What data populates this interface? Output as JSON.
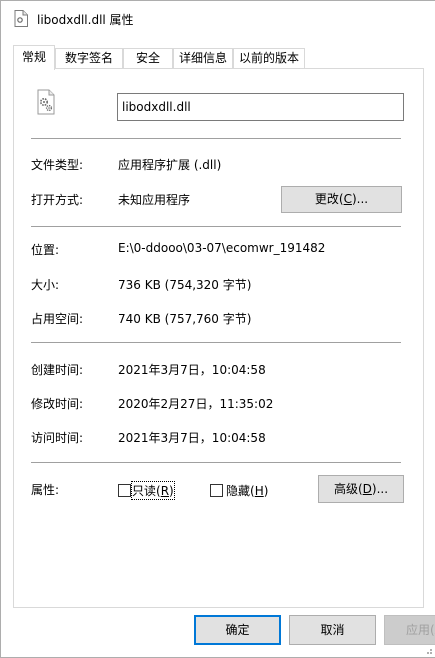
{
  "window": {
    "title": "libodxdll.dll 属性"
  },
  "tabs": [
    {
      "label": "常规"
    },
    {
      "label": "数字签名"
    },
    {
      "label": "安全"
    },
    {
      "label": "详细信息"
    },
    {
      "label": "以前的版本"
    }
  ],
  "file": {
    "name": "libodxdll.dll",
    "icon": "dll-gear-icon"
  },
  "props": {
    "type_label": "文件类型:",
    "type_value": "应用程序扩展 (.dll)",
    "opens_label": "打开方式:",
    "opens_value": "未知应用程序",
    "change_button": "更改(C)...",
    "change_mn_pre": "更改(",
    "change_mn": "C",
    "change_mn_post": ")...",
    "location_label": "位置:",
    "location_value": "E:\\0-ddooo\\03-07\\ecomwr_191482",
    "size_label": "大小:",
    "size_value": "736 KB (754,320 字节)",
    "disk_label": "占用空间:",
    "disk_value": "740 KB (757,760 字节)",
    "created_label": "创建时间:",
    "created_value": "2021年3月7日，10:04:58",
    "modified_label": "修改时间:",
    "modified_value": "2020年2月27日，11:35:02",
    "accessed_label": "访问时间:",
    "accessed_value": "2021年3月7日，10:04:58",
    "attrs_label": "属性:",
    "readonly_pre": "只读(",
    "readonly_mn": "R",
    "readonly_post": ")",
    "hidden_pre": "隐藏(",
    "hidden_mn": "H",
    "hidden_post": ")",
    "advanced_pre": "高级(",
    "advanced_mn": "D",
    "advanced_post": ")..."
  },
  "footer": {
    "ok": "确定",
    "cancel": "取消",
    "apply": "应用(A)"
  },
  "colors": {
    "focus_border": "#0078d7",
    "button_face": "#e1e1e1",
    "separator": "#a0a0a0"
  }
}
